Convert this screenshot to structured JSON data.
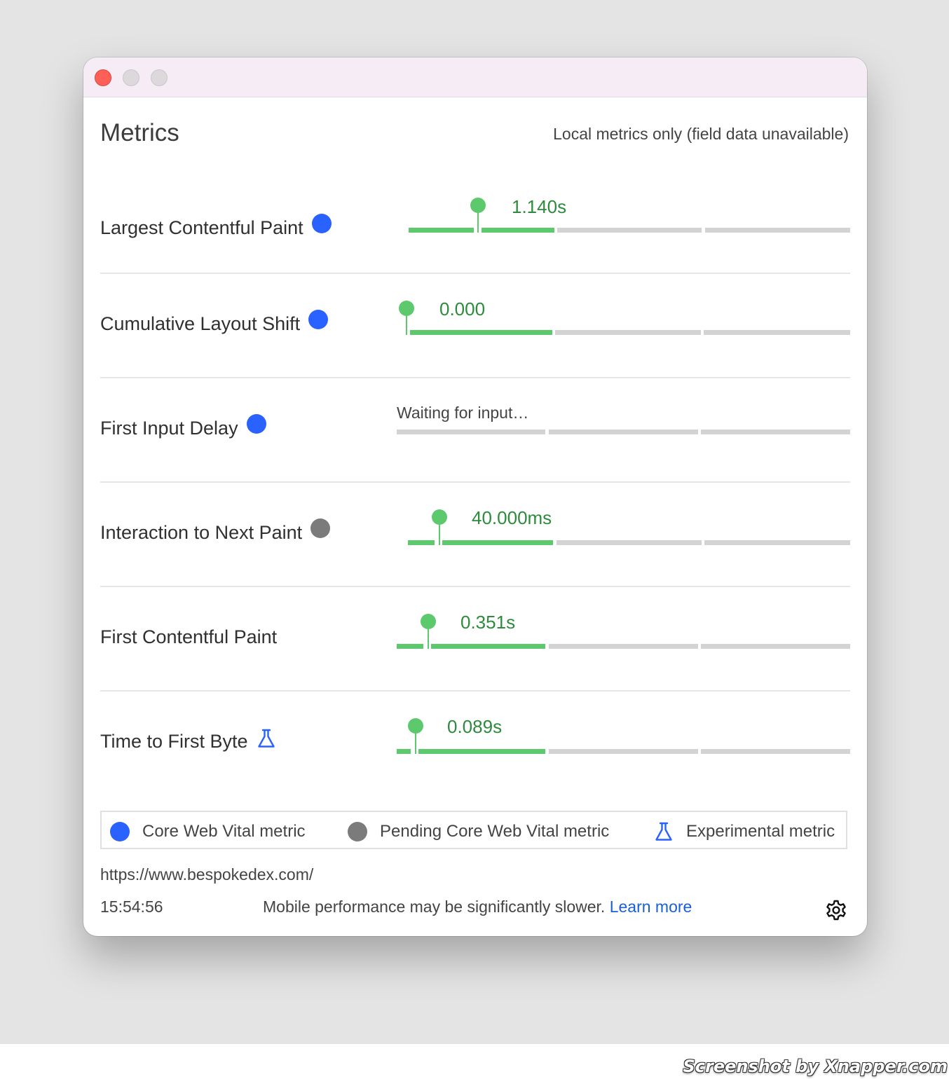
{
  "page": {
    "heading": "Metrics",
    "field_note": "Local metrics only (field data unavailable)",
    "colors": {
      "good": "#5cc96c",
      "value_text": "#2e8b3e",
      "core_web_vital": "#2962ff",
      "pending": "#7b7b7b",
      "link": "#1a5fd6"
    }
  },
  "metrics": [
    {
      "name": "Largest Contentful Paint",
      "badge": "core-web-vital",
      "value": "1.140s"
    },
    {
      "name": "Cumulative Layout Shift",
      "badge": "core-web-vital",
      "value": "0.000"
    },
    {
      "name": "First Input Delay",
      "badge": "core-web-vital",
      "status": "Waiting for input…"
    },
    {
      "name": "Interaction to Next Paint",
      "badge": "pending-core-web-vital",
      "value": "40.000ms"
    },
    {
      "name": "First Contentful Paint",
      "badge": "none",
      "value": "0.351s"
    },
    {
      "name": "Time to First Byte",
      "badge": "experimental",
      "value": "0.089s"
    }
  ],
  "legend": {
    "core": "Core Web Vital metric",
    "pending": "Pending Core Web Vital metric",
    "experimental": "Experimental metric"
  },
  "footer": {
    "url": "https://www.bespokedex.com/",
    "time": "15:54:56",
    "mobile_note": "Mobile performance may be significantly slower.",
    "learn_more": "Learn more",
    "settings_icon": "gear-icon"
  },
  "watermark": "Screenshot by Xnapper.com"
}
